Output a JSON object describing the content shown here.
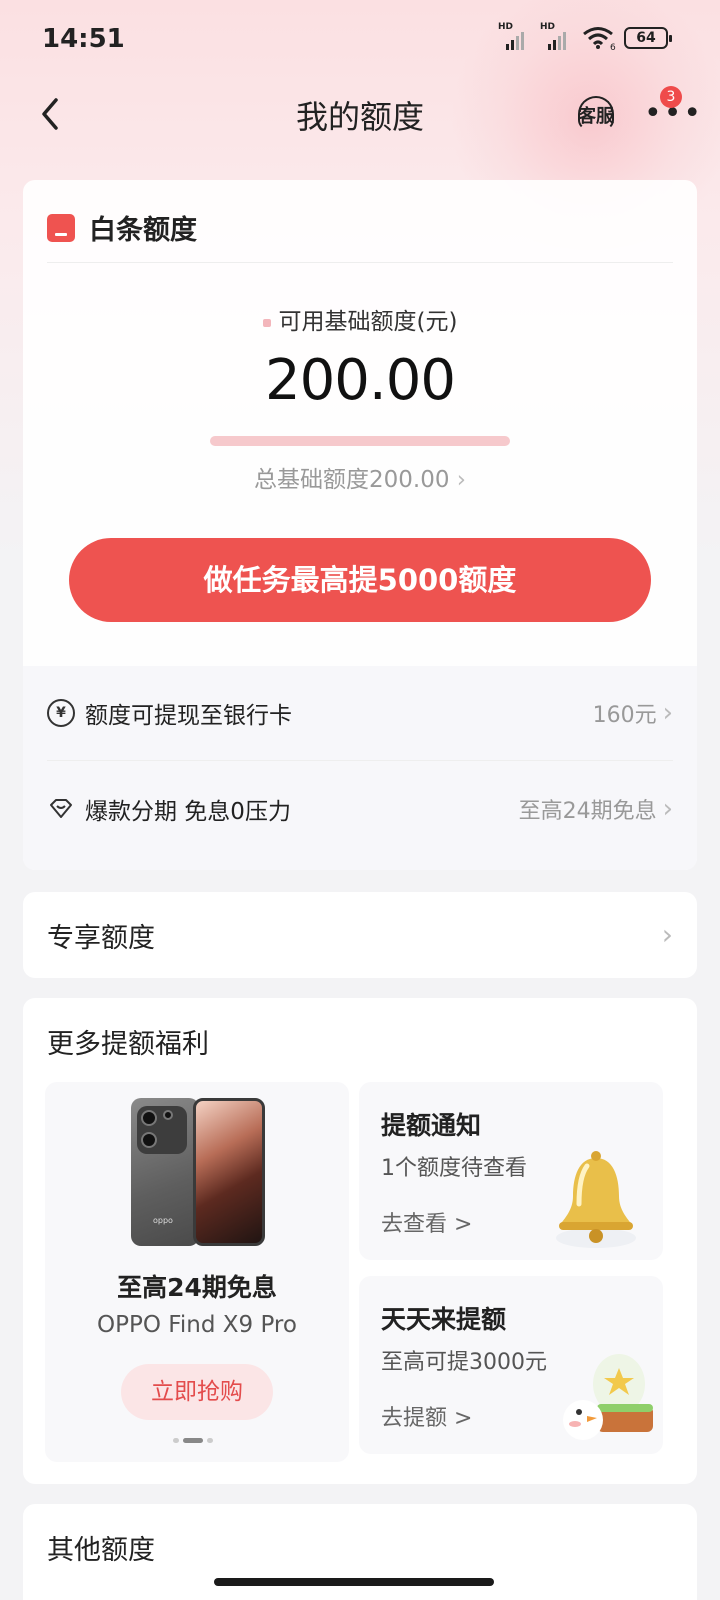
{
  "status_bar": {
    "time": "14:51",
    "sim1_label": "HD",
    "sim2_label": "HD",
    "wifi_label": "6",
    "battery": "64"
  },
  "nav": {
    "title": "我的额度",
    "service_label": "客服",
    "more_badge": "3"
  },
  "baitiao_card": {
    "title": "白条额度",
    "available_label": "可用基础额度(元)",
    "available_amount": "200.00",
    "total_label": "总基础额度200.00",
    "cta_label": "做任务最高提5000额度",
    "rows": [
      {
        "label": "额度可提现至银行卡",
        "value": "160元"
      },
      {
        "label": "爆款分期 免息0压力",
        "value": "至高24期免息"
      }
    ]
  },
  "exclusive_card": {
    "title": "专享额度"
  },
  "benefits_card": {
    "title": "更多提额福利",
    "promo": {
      "headline": "至高24期免息",
      "product": "OPPO Find X9 Pro",
      "button": "立即抢购",
      "phone_brand": "oppo"
    },
    "tiles": [
      {
        "title": "提额通知",
        "subtitle": "1个额度待查看",
        "action": "去查看 >"
      },
      {
        "title": "天天来提额",
        "subtitle": "至高可提3000元",
        "action": "去提额 >"
      }
    ]
  },
  "other_card": {
    "title": "其他额度"
  },
  "colors": {
    "accent": "#ee5350",
    "badge": "#ef4b4b",
    "background": "#f3f3f5"
  }
}
